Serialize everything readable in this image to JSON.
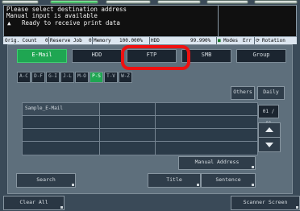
{
  "header": {
    "tabs": [
      {
        "label": ""
      },
      {
        "label": ""
      },
      {
        "label": ""
      },
      {
        "label": ""
      },
      {
        "label": ""
      },
      {
        "label": ""
      }
    ],
    "active_tab_index": 1
  },
  "messages": {
    "line1": "Please select destination address",
    "line2": "Manual input is available",
    "line3": "Ready to receive print data"
  },
  "status": {
    "orig_count_label": "Orig. Count",
    "orig_count_value": "0",
    "reserve_job_label": "Reserve Job",
    "reserve_job_value": "0",
    "memory_label": "Memory",
    "memory_value": "100.000%",
    "hdd_label": "HDD",
    "hdd_value": "99.990%",
    "modes": "Modes",
    "err": "Err",
    "rotation": "Rotation"
  },
  "destination_tabs": [
    {
      "label": "E-Mail"
    },
    {
      "label": "HDD"
    },
    {
      "label": "FTP"
    },
    {
      "label": "SMB"
    },
    {
      "label": "Group"
    }
  ],
  "letter_tabs": [
    {
      "label": "A-C"
    },
    {
      "label": "D-F"
    },
    {
      "label": "G-I"
    },
    {
      "label": "J-L"
    },
    {
      "label": "M-O"
    },
    {
      "label": "P-S"
    },
    {
      "label": "T-V"
    },
    {
      "label": "W-Z"
    }
  ],
  "side_buttons": {
    "others": "Others",
    "daily": "Daily"
  },
  "address_list": {
    "items": [
      "Sample_E-Mail",
      "",
      "",
      "",
      "",
      "",
      "",
      "",
      "",
      "",
      "",
      ""
    ]
  },
  "pagination": {
    "page": "01 / 01"
  },
  "buttons": {
    "manual_address": "Manual Address",
    "search": "Search",
    "title": "Title",
    "sentence": "Sentence",
    "clear_all": "Clear All",
    "scanner_screen": "Scanner Screen"
  }
}
